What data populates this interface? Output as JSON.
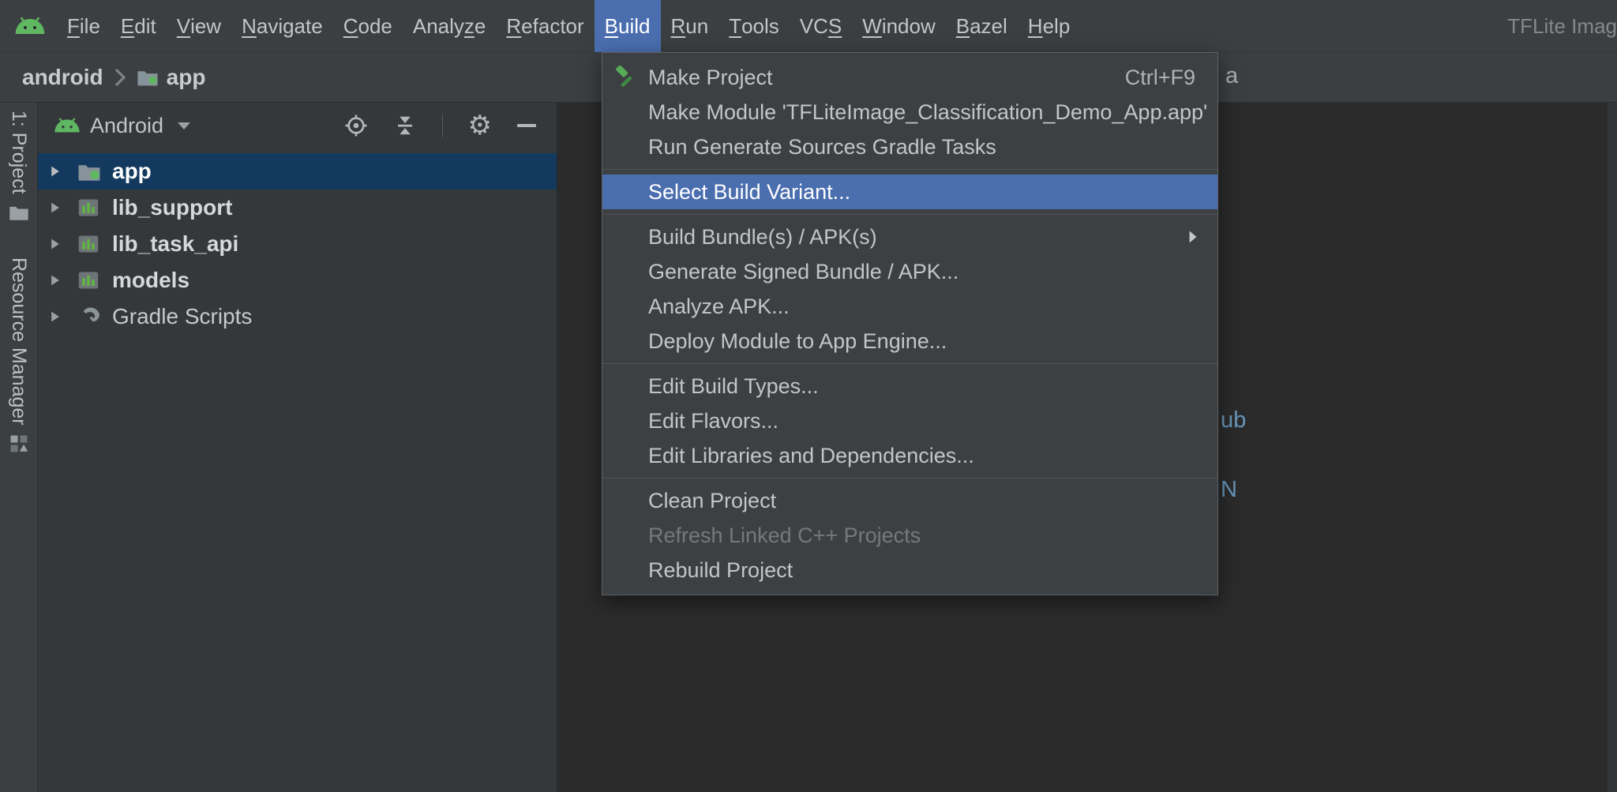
{
  "colors": {
    "accent_blue": "#4b6eaf",
    "tree_selection_blue": "#133a5e",
    "android_green": "#5fb762",
    "menu_bg": "#3c3f41",
    "panel_bg": "#34383b",
    "editor_bg": "#2b2b2b",
    "text": "#bbbbbb",
    "disabled_text": "#75797c",
    "code_blue": "#6897bb"
  },
  "menubar": {
    "items": [
      {
        "label": "File",
        "u": 0
      },
      {
        "label": "Edit",
        "u": 0
      },
      {
        "label": "View",
        "u": 0
      },
      {
        "label": "Navigate",
        "u": 0
      },
      {
        "label": "Code",
        "u": 0
      },
      {
        "label": "Analyze",
        "u": 5
      },
      {
        "label": "Refactor",
        "u": 0
      },
      {
        "label": "Build",
        "u": 0,
        "active": true
      },
      {
        "label": "Run",
        "u": 0
      },
      {
        "label": "Tools",
        "u": 0
      },
      {
        "label": "VCS",
        "u": 2
      },
      {
        "label": "Window",
        "u": 0
      },
      {
        "label": "Bazel",
        "u": 0
      },
      {
        "label": "Help",
        "u": 0
      }
    ],
    "window_title": "TFLite Imag"
  },
  "breadcrumb": {
    "project": "android",
    "module": "app"
  },
  "left_stripe": {
    "buttons": [
      {
        "label": "1: Project",
        "icon": "project-tool-icon"
      },
      {
        "label": "Resource Manager",
        "icon": "resource-manager-icon"
      }
    ]
  },
  "project_panel": {
    "view_label": "Android",
    "header_icons": [
      "locate-target-icon",
      "collapse-all-icon",
      "gear-icon",
      "hide-icon"
    ],
    "tree": [
      {
        "label": "app",
        "icon": "app-folder-icon",
        "bold": true,
        "selected": true
      },
      {
        "label": "lib_support",
        "icon": "module-icon",
        "bold": true
      },
      {
        "label": "lib_task_api",
        "icon": "module-icon",
        "bold": true
      },
      {
        "label": "models",
        "icon": "module-icon",
        "bold": true
      },
      {
        "label": "Gradle Scripts",
        "icon": "gradle-icon",
        "bold": false
      }
    ]
  },
  "build_menu": {
    "items": [
      {
        "label": "Make Project",
        "icon": "hammer-icon",
        "shortcut": "Ctrl+F9"
      },
      {
        "label": "Make Module 'TFLiteImage_Classification_Demo_App.app'"
      },
      {
        "label": "Run Generate Sources Gradle Tasks"
      },
      {
        "label": "Select Build Variant...",
        "highlighted": true
      },
      {
        "label": "Build Bundle(s) / APK(s)",
        "submenu": true
      },
      {
        "label": "Generate Signed Bundle / APK..."
      },
      {
        "label": "Analyze APK..."
      },
      {
        "label": "Deploy Module to App Engine..."
      },
      {
        "label": "Edit Build Types..."
      },
      {
        "label": "Edit Flavors..."
      },
      {
        "label": "Edit Libraries and Dependencies..."
      },
      {
        "label": "Clean Project"
      },
      {
        "label": "Refresh Linked C++ Projects",
        "disabled": true
      },
      {
        "label": "Rebuild Project"
      }
    ]
  },
  "editor_fragments": [
    {
      "text": "a",
      "color": "#a9adb0"
    },
    {
      "text": "ub",
      "color": "#6897bb"
    },
    {
      "text": "N",
      "color": "#6897bb"
    }
  ],
  "icons": {
    "gear": "⚙",
    "hide": "—",
    "chevron": "›"
  }
}
